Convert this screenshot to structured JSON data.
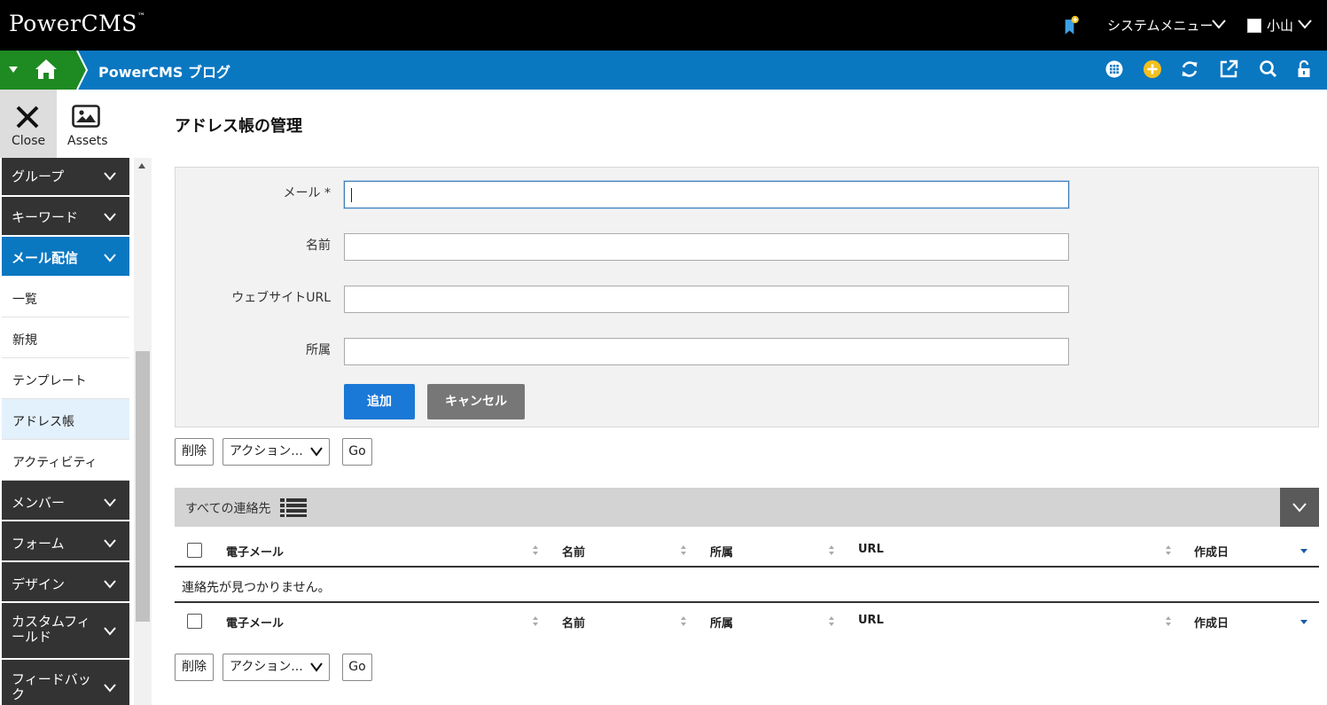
{
  "header": {
    "logo": "PowerCMS",
    "logo_tm": "™",
    "system_menu": "システムメニュー",
    "user_name": "小山"
  },
  "blue_bar": {
    "blog_title": "PowerCMS ブログ"
  },
  "side_tools": {
    "close_label": "Close",
    "assets_label": "Assets"
  },
  "sidebar": {
    "items": [
      {
        "label": "グループ"
      },
      {
        "label": "キーワード"
      },
      {
        "label": "メール配信"
      },
      {
        "label": "メンバー"
      },
      {
        "label": "フォーム"
      },
      {
        "label": "デザイン"
      },
      {
        "label": "カスタムフィールド"
      },
      {
        "label": "フィードバック"
      }
    ],
    "sub_items": [
      {
        "label": "一覧"
      },
      {
        "label": "新規"
      },
      {
        "label": "テンプレート"
      },
      {
        "label": "アドレス帳"
      },
      {
        "label": "アクティビティ"
      }
    ]
  },
  "main": {
    "page_title": "アドレス帳の管理",
    "form": {
      "email_label": "メール *",
      "email_value": "",
      "name_label": "名前",
      "name_value": "",
      "url_label": "ウェブサイトURL",
      "url_value": "",
      "affiliation_label": "所属",
      "affiliation_value": "",
      "add_button": "追加",
      "cancel_button": "キャンセル"
    },
    "actions": {
      "delete_button": "削除",
      "action_select": "アクション...",
      "go_button": "Go"
    },
    "list": {
      "title": "すべての連絡先",
      "columns": [
        "電子メール",
        "名前",
        "所属",
        "URL",
        "作成日"
      ],
      "empty_message": "連絡先が見つかりません。"
    }
  },
  "colors": {
    "top_bar": "#000000",
    "blue_bar": "#0a77c1",
    "home_green": "#1e8a22",
    "nav_dark": "#333333",
    "nav_active": "#0a77c1",
    "add_button": "#1a78d6",
    "cancel_button": "#777777"
  }
}
